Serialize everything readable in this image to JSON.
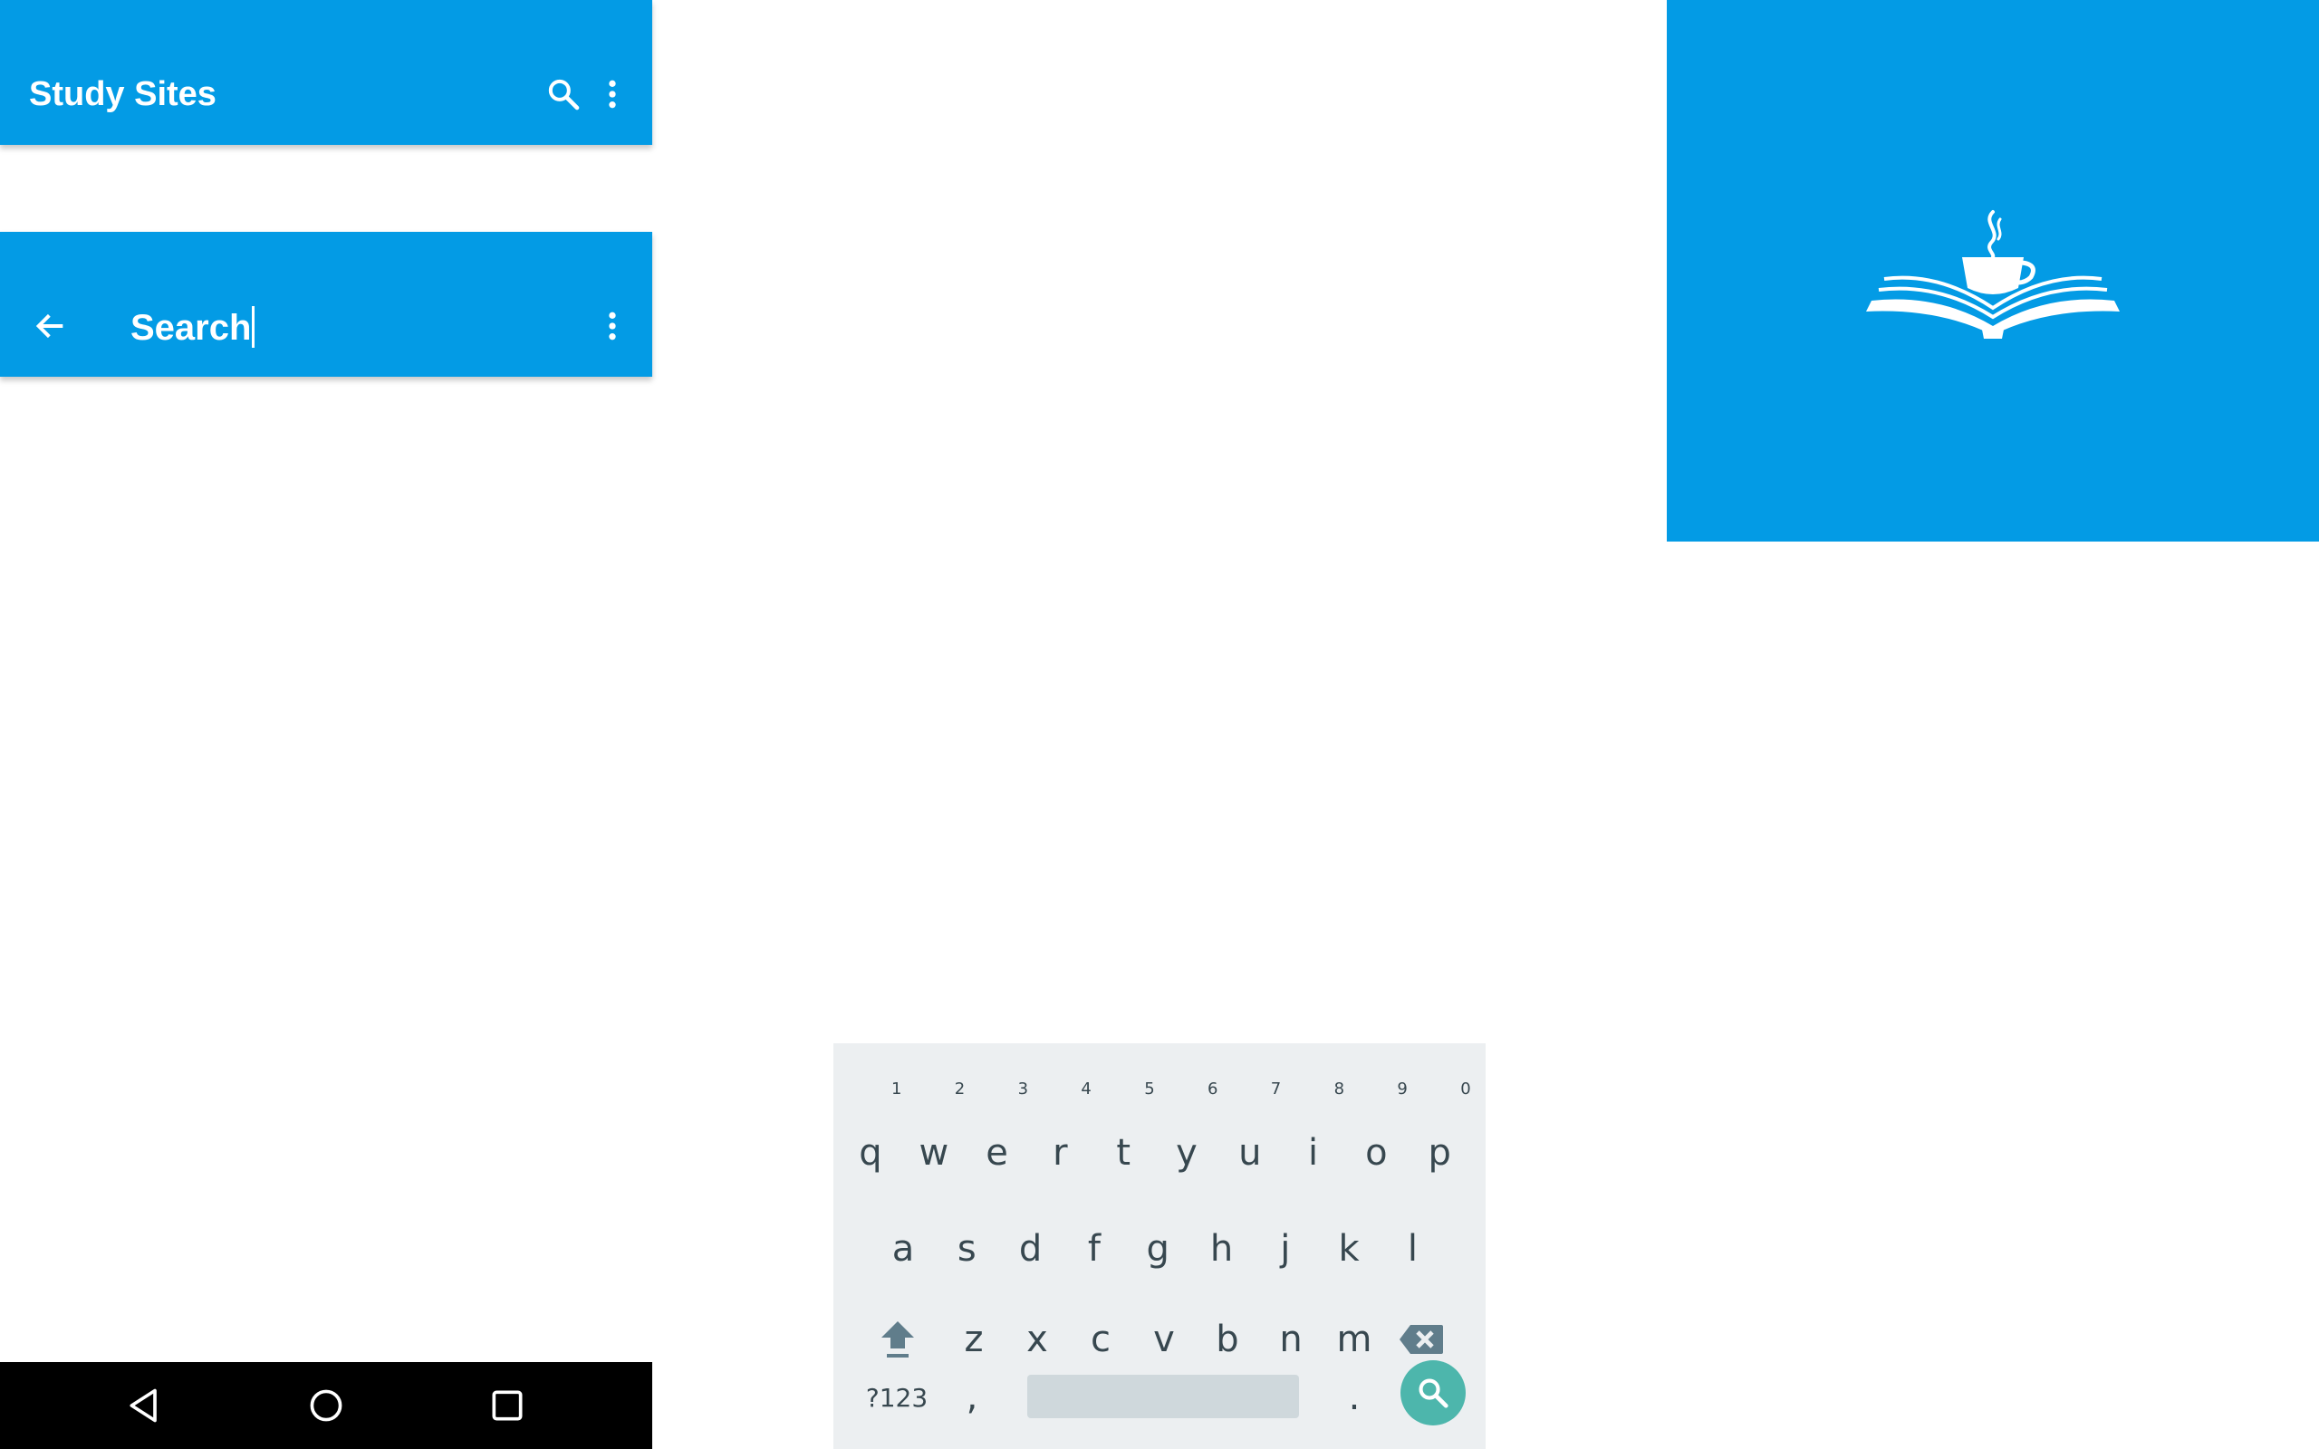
{
  "appbar_main": {
    "title": "Study Sites",
    "search_icon": "search-icon",
    "menu_icon": "more-vert-icon"
  },
  "appbar_search": {
    "query": "Search",
    "back_icon": "arrow-back-icon",
    "menu_icon": "more-vert-icon"
  },
  "splash": {
    "logo": "open-book-with-coffee-cup-logo"
  },
  "navbar": {
    "back": "triangle-back-icon",
    "home": "circle-home-icon",
    "recents": "square-recents-icon"
  },
  "keyboard": {
    "row1": [
      "q",
      "w",
      "e",
      "r",
      "t",
      "y",
      "u",
      "i",
      "o",
      "p"
    ],
    "row1_hints": [
      "1",
      "2",
      "3",
      "4",
      "5",
      "6",
      "7",
      "8",
      "9",
      "0"
    ],
    "row2": [
      "a",
      "s",
      "d",
      "f",
      "g",
      "h",
      "j",
      "k",
      "l"
    ],
    "row3": [
      "z",
      "x",
      "c",
      "v",
      "b",
      "n",
      "m"
    ],
    "symbols_label": "?123",
    "comma": ",",
    "period": ".",
    "shift_icon": "shift-arrow-icon",
    "backspace_icon": "backspace-icon",
    "action_icon": "search-icon"
  },
  "colors": {
    "primary": "#039BE5",
    "keyboard_bg": "#ECEFF1",
    "key_text": "#37474F",
    "fab": "#4DB6AC"
  }
}
